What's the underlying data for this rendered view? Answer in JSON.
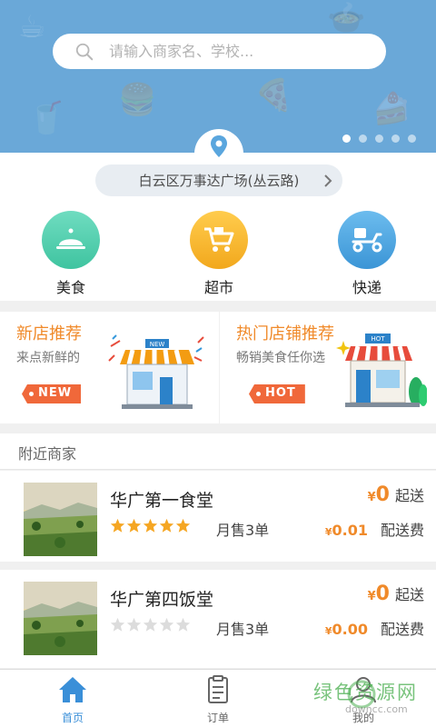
{
  "search": {
    "placeholder": "请输入商家名、学校..."
  },
  "banner": {
    "page_count": 5,
    "active_index": 0
  },
  "location": {
    "text": "白云区万事达广场(丛云路)"
  },
  "categories": [
    {
      "label": "美食",
      "icon": "food-cover-icon",
      "color": "#4fd0b0"
    },
    {
      "label": "超市",
      "icon": "shopping-cart-icon",
      "color": "#f7b731"
    },
    {
      "label": "快递",
      "icon": "scooter-icon",
      "color": "#4ea8e0"
    }
  ],
  "promos": [
    {
      "title": "新店推荐",
      "subtitle": "来点新鲜的",
      "tag": "NEW",
      "sign": "NEW"
    },
    {
      "title": "热门店铺推荐",
      "subtitle": "畅销美食任你选",
      "tag": "HOT",
      "sign": "HOT"
    }
  ],
  "nearby": {
    "title": "附近商家"
  },
  "shops": [
    {
      "name": "华广第一食堂",
      "rating": 5,
      "sales": "月售3单",
      "min_order_currency": "¥",
      "min_order": "0",
      "min_order_label": "起送",
      "fee_currency": "¥",
      "fee": "0.01",
      "fee_label": "配送费"
    },
    {
      "name": "华广第四饭堂",
      "rating": 0,
      "sales": "月售3单",
      "min_order_currency": "¥",
      "min_order": "0",
      "min_order_label": "起送",
      "fee_currency": "¥",
      "fee": "0.00",
      "fee_label": "配送费"
    }
  ],
  "tabbar": [
    {
      "label": "首页",
      "icon": "home-icon",
      "active": true
    },
    {
      "label": "订单",
      "icon": "order-icon",
      "active": false
    },
    {
      "label": "我的",
      "icon": "profile-icon",
      "active": false
    }
  ],
  "watermark": {
    "text": "绿色资源网",
    "url": "downcc.com"
  },
  "colors": {
    "accent": "#f08a2a",
    "banner": "#6aa8d8",
    "tab_active": "#3a8fd8",
    "tag": "#f0683a"
  }
}
